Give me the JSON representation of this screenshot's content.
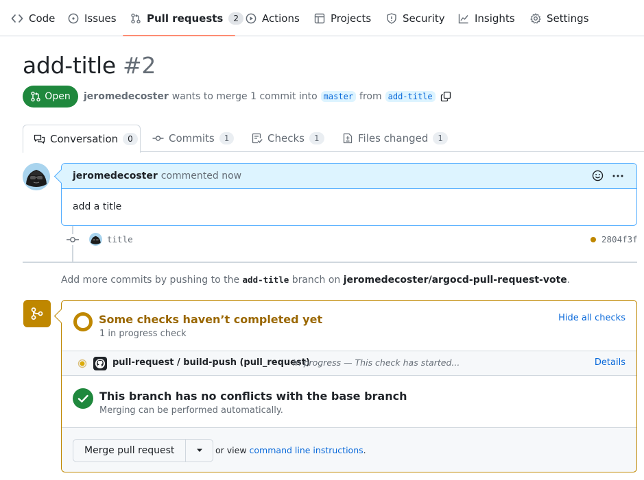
{
  "repo_nav": {
    "items": [
      {
        "label": "Code"
      },
      {
        "label": "Issues"
      },
      {
        "label": "Pull requests",
        "count": "2"
      },
      {
        "label": "Actions"
      },
      {
        "label": "Projects"
      },
      {
        "label": "Security"
      },
      {
        "label": "Insights"
      },
      {
        "label": "Settings"
      }
    ],
    "selected": "Pull requests"
  },
  "pr": {
    "title": "add-title",
    "number": "#2",
    "state": "Open",
    "author": "jeromedecoster",
    "meta_text": "wants to merge 1 commit into",
    "base_branch": "master",
    "from_text": "from",
    "head_branch": "add-title"
  },
  "tabs": [
    {
      "label": "Conversation",
      "count": "0"
    },
    {
      "label": "Commits",
      "count": "1"
    },
    {
      "label": "Checks",
      "count": "1"
    },
    {
      "label": "Files changed",
      "count": "1"
    }
  ],
  "comment": {
    "author": "jeromedecoster",
    "action": "commented now",
    "body": "add a title"
  },
  "commit": {
    "message": "title",
    "sha": "2804f3f",
    "status_color": "#bf8700"
  },
  "push_hint": {
    "prefix": "Add more commits by pushing to the",
    "branch": "add-title",
    "middle": "branch on",
    "repo": "jeromedecoster/argocd-pull-request-vote",
    "suffix": "."
  },
  "merge_box": {
    "checks_title": "Some checks haven’t completed yet",
    "checks_sub": "1 in progress check",
    "hide_link": "Hide all checks",
    "check_name": "pull-request / build-push (pull_request)",
    "check_status": "In progress — This check has started...",
    "details_link": "Details",
    "conflicts_title": "This branch has no conflicts with the base branch",
    "conflicts_sub": "Merging can be performed automatically.",
    "merge_button": "Merge pull request",
    "view_prefix": "or view",
    "cli_link": "command line instructions",
    "view_suffix": "."
  },
  "colors": {
    "open_green": "#1f883d",
    "pending_amber": "#bf8700",
    "link_blue": "#0969da",
    "nav_accent": "#fd8c73"
  }
}
